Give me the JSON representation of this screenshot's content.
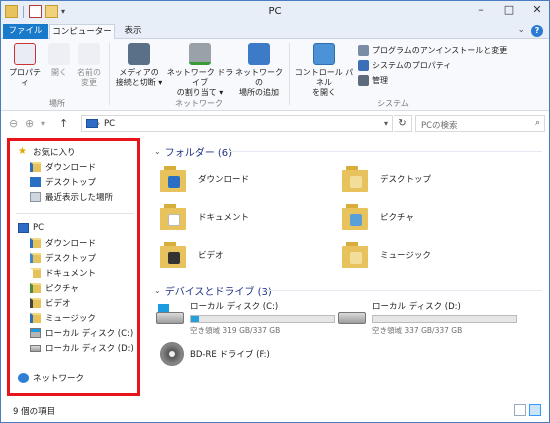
{
  "window": {
    "title": "PC"
  },
  "ribbon": {
    "tabs": {
      "file": "ファイル",
      "computer": "コンピューター",
      "view": "表示"
    },
    "location": {
      "group_label": "場所",
      "properties": [
        "プロパティ"
      ],
      "open": [
        "開く"
      ],
      "rename": [
        "名前の",
        "変更"
      ]
    },
    "network": {
      "group_label": "ネットワーク",
      "media": [
        "メディアの",
        "接続と切断 ▾"
      ],
      "map_drive": [
        "ネットワーク ドライブ",
        "の割り当て ▾"
      ],
      "add_location": [
        "ネットワークの",
        "場所の追加"
      ]
    },
    "system": {
      "group_label": "システム",
      "control_panel": [
        "コントロール パネル",
        "を開く"
      ],
      "uninstall": "プログラムのアンインストールと変更",
      "system_properties": "システムのプロパティ",
      "manage": "管理"
    }
  },
  "address": {
    "crumb": "PC",
    "search_placeholder": "PCの検索"
  },
  "navpane": {
    "favorites": {
      "label": "お気に入り",
      "items": [
        "ダウンロード",
        "デスクトップ",
        "最近表示した場所"
      ]
    },
    "pc": {
      "label": "PC",
      "items": [
        "ダウンロード",
        "デスクトップ",
        "ドキュメント",
        "ピクチャ",
        "ビデオ",
        "ミュージック",
        "ローカル ディスク (C:)",
        "ローカル ディスク (D:)"
      ]
    },
    "network": {
      "label": "ネットワーク"
    }
  },
  "content": {
    "folders_header": "フォルダー (6)",
    "folders": [
      "ダウンロード",
      "デスクトップ",
      "ドキュメント",
      "ピクチャ",
      "ビデオ",
      "ミュージック"
    ],
    "drives_header": "デバイスとドライブ (3)",
    "drives": [
      {
        "name": "ローカル ディスク (C:)",
        "free": "空き領域 319 GB/337 GB",
        "used_fraction": 0.053
      },
      {
        "name": "ローカル ディスク (D:)",
        "free": "空き領域 337 GB/337 GB",
        "used_fraction": 0.0
      },
      {
        "name": "BD-RE ドライブ (F:)"
      }
    ]
  },
  "status": {
    "item_count": "9 個の項目"
  },
  "colors": {
    "accent": "#1979ca",
    "highlight_border": "#e8141b",
    "drive_bar": "#26a0da",
    "section_header": "#1e3287"
  }
}
